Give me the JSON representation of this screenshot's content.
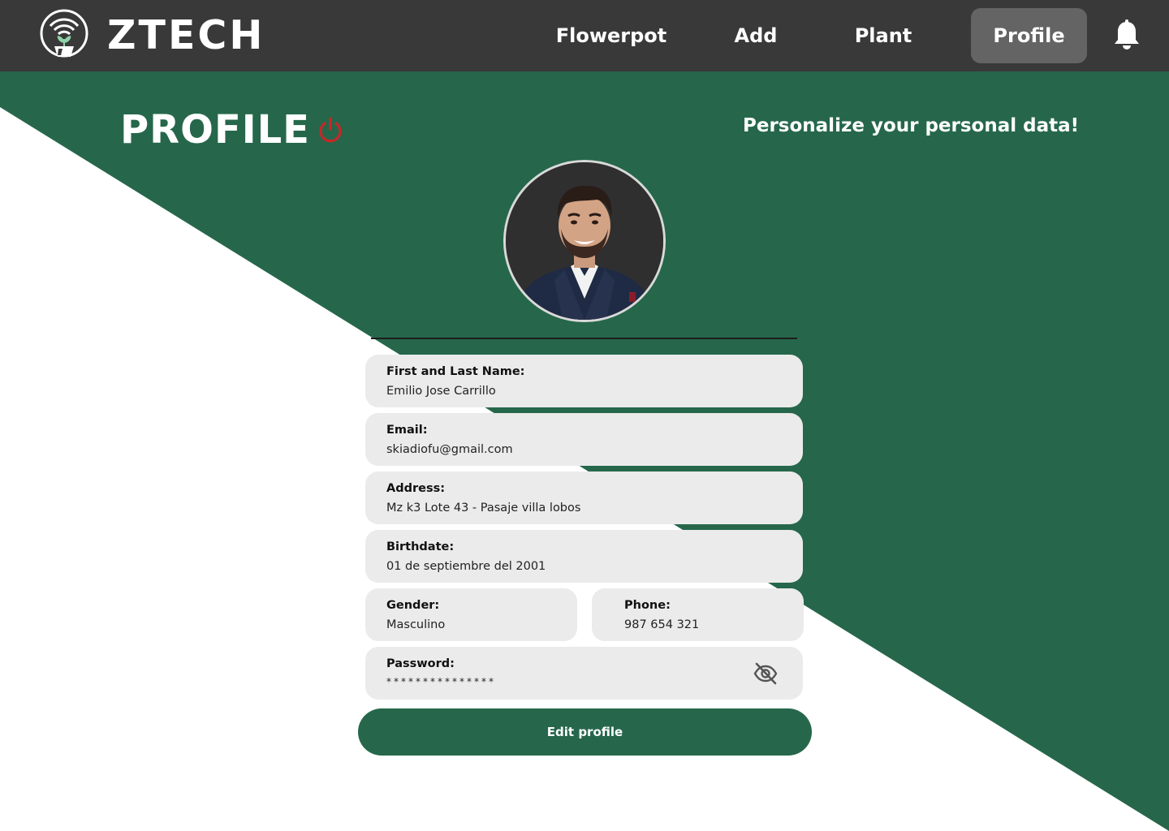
{
  "app": {
    "brand": "ZTECH"
  },
  "nav": {
    "items": [
      {
        "label": "Flowerpot",
        "active": false
      },
      {
        "label": "Add",
        "active": false
      },
      {
        "label": "Plant",
        "active": false
      },
      {
        "label": "Profile",
        "active": true
      }
    ],
    "notification_icon": "bell-icon"
  },
  "header": {
    "title": "PROFILE",
    "tagline": "Personalize your personal data!",
    "logout_icon": "power-icon"
  },
  "profile": {
    "avatar_icon": "user-photo",
    "fields": {
      "name": {
        "label": "First and Last Name:",
        "value": "Emilio Jose Carrillo"
      },
      "email": {
        "label": "Email:",
        "value": "skiadiofu@gmail.com"
      },
      "address": {
        "label": "Address:",
        "value": "Mz k3 Lote 43 - Pasaje villa lobos"
      },
      "birthdate": {
        "label": "Birthdate:",
        "value": "01 de septiembre del 2001"
      },
      "gender": {
        "label": "Gender:",
        "value": "Masculino"
      },
      "phone": {
        "label": "Phone:",
        "value": "987 654 321"
      },
      "password": {
        "label": "Password:",
        "value": "***************",
        "toggle_icon": "eye-off-icon"
      }
    },
    "edit_button": "Edit profile"
  },
  "colors": {
    "navbar": "#393939",
    "nav_active": "#646464",
    "accent_green": "#26674b",
    "field_bg": "#ebebeb",
    "logout_red": "#c62828"
  }
}
